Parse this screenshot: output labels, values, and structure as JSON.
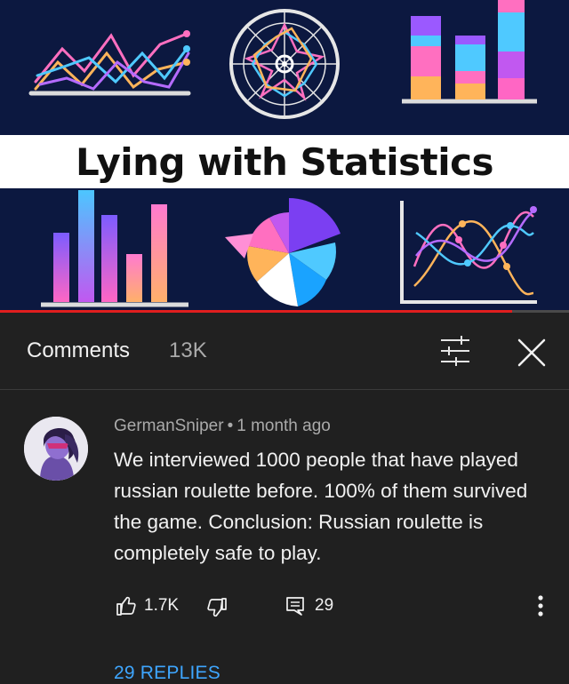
{
  "thumbnail": {
    "title": "Lying with Statistics",
    "progress_fraction": 0.9
  },
  "comments_panel": {
    "title": "Comments",
    "count": "13K",
    "icons": {
      "filter": "sort-filter-icon",
      "close": "close-icon"
    }
  },
  "comment": {
    "author": "GermanSniper",
    "separator": "•",
    "time": "1 month ago",
    "text": "We interviewed 1000 people that have played russian roulette before. 100% of them survived the game. Conclusion: Russian roulette is completely safe to play.",
    "likes": "1.7K",
    "replies_count": "29",
    "replies_link": "29 REPLIES",
    "icons": {
      "like": "thumbs-up-icon",
      "dislike": "thumbs-down-icon",
      "reply": "reply-icon",
      "more": "more-vertical-icon"
    }
  },
  "colors": {
    "background": "#202020",
    "link": "#3ea6ff",
    "progress": "#e01e1e",
    "thumbnail_bg": "#0c1840"
  }
}
